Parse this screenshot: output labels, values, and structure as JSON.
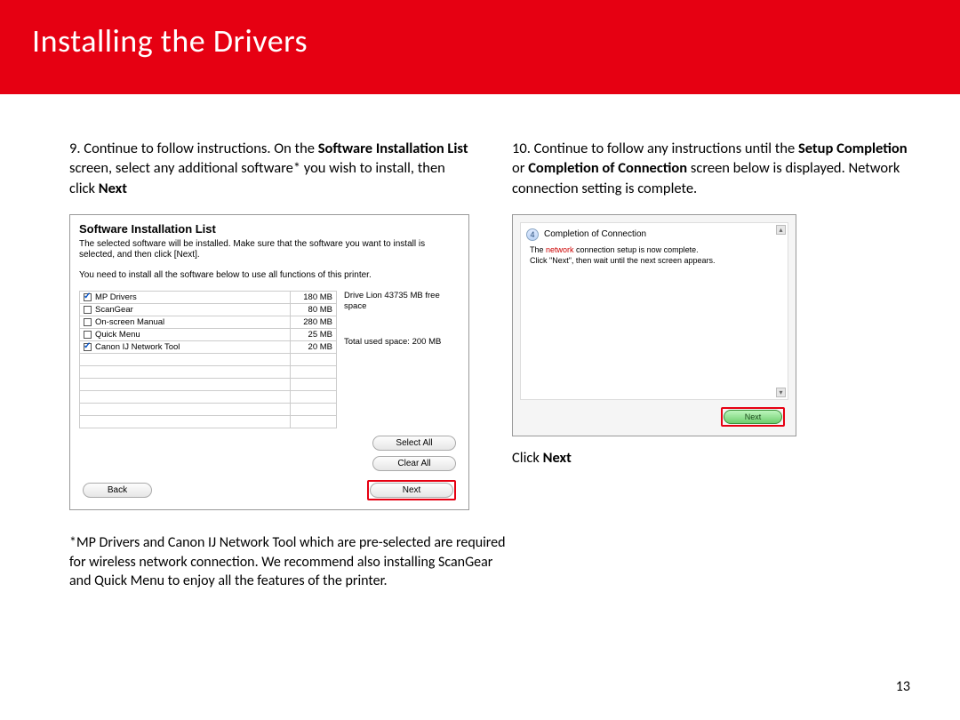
{
  "banner": {
    "title": "Installing  the Drivers"
  },
  "left": {
    "num": "9. ",
    "t1": "Continue to follow instructions.  On the ",
    "b1": "Software Installation List",
    "t2": " screen, select any additional software* you wish to install, then click ",
    "b2": "Next"
  },
  "shot1": {
    "title": "Software Installation List",
    "desc": "The selected software will be installed. Make sure that the software you want to install is selected, and then click [Next].",
    "note": "You need to install all the software below to use all functions of this printer.",
    "rows": [
      {
        "checked": true,
        "name": "MP Drivers",
        "size": "180 MB"
      },
      {
        "checked": false,
        "name": "ScanGear",
        "size": "80 MB"
      },
      {
        "checked": false,
        "name": "On-screen Manual",
        "size": "280 MB"
      },
      {
        "checked": false,
        "name": "Quick Menu",
        "size": "25 MB"
      },
      {
        "checked": true,
        "name": "Canon IJ Network Tool",
        "size": "20 MB"
      }
    ],
    "emptyRows": 6,
    "freeSpace": "Drive Lion 43735 MB free space",
    "usedSpace": "Total used space: 200 MB",
    "selectAll": "Select All",
    "clearAll": "Clear All",
    "back": "Back",
    "next": "Next"
  },
  "right": {
    "num": "10. ",
    "t1": "Continue to follow any instructions until the ",
    "b1": "Setup Completion",
    "t2": " or ",
    "b2": "Completion of Connection",
    "t3": " screen below is displayed. Network connection setting is complete."
  },
  "shot2": {
    "stepNum": "4",
    "heading": "Completion of Connection",
    "line1a": "The ",
    "line1b": "network",
    "line1c": " connection setup is now complete.",
    "line2": "Click \"Next\", then wait until the next screen appears.",
    "next": "Next"
  },
  "clickNext": {
    "pre": "Click ",
    "b": "Next"
  },
  "footnote": "*MP Drivers and Canon IJ Network Tool which are pre-selected are required for wireless network connection.  We recommend also installing ScanGear and Quick Menu to enjoy all the features of the printer.",
  "pageNum": "13"
}
